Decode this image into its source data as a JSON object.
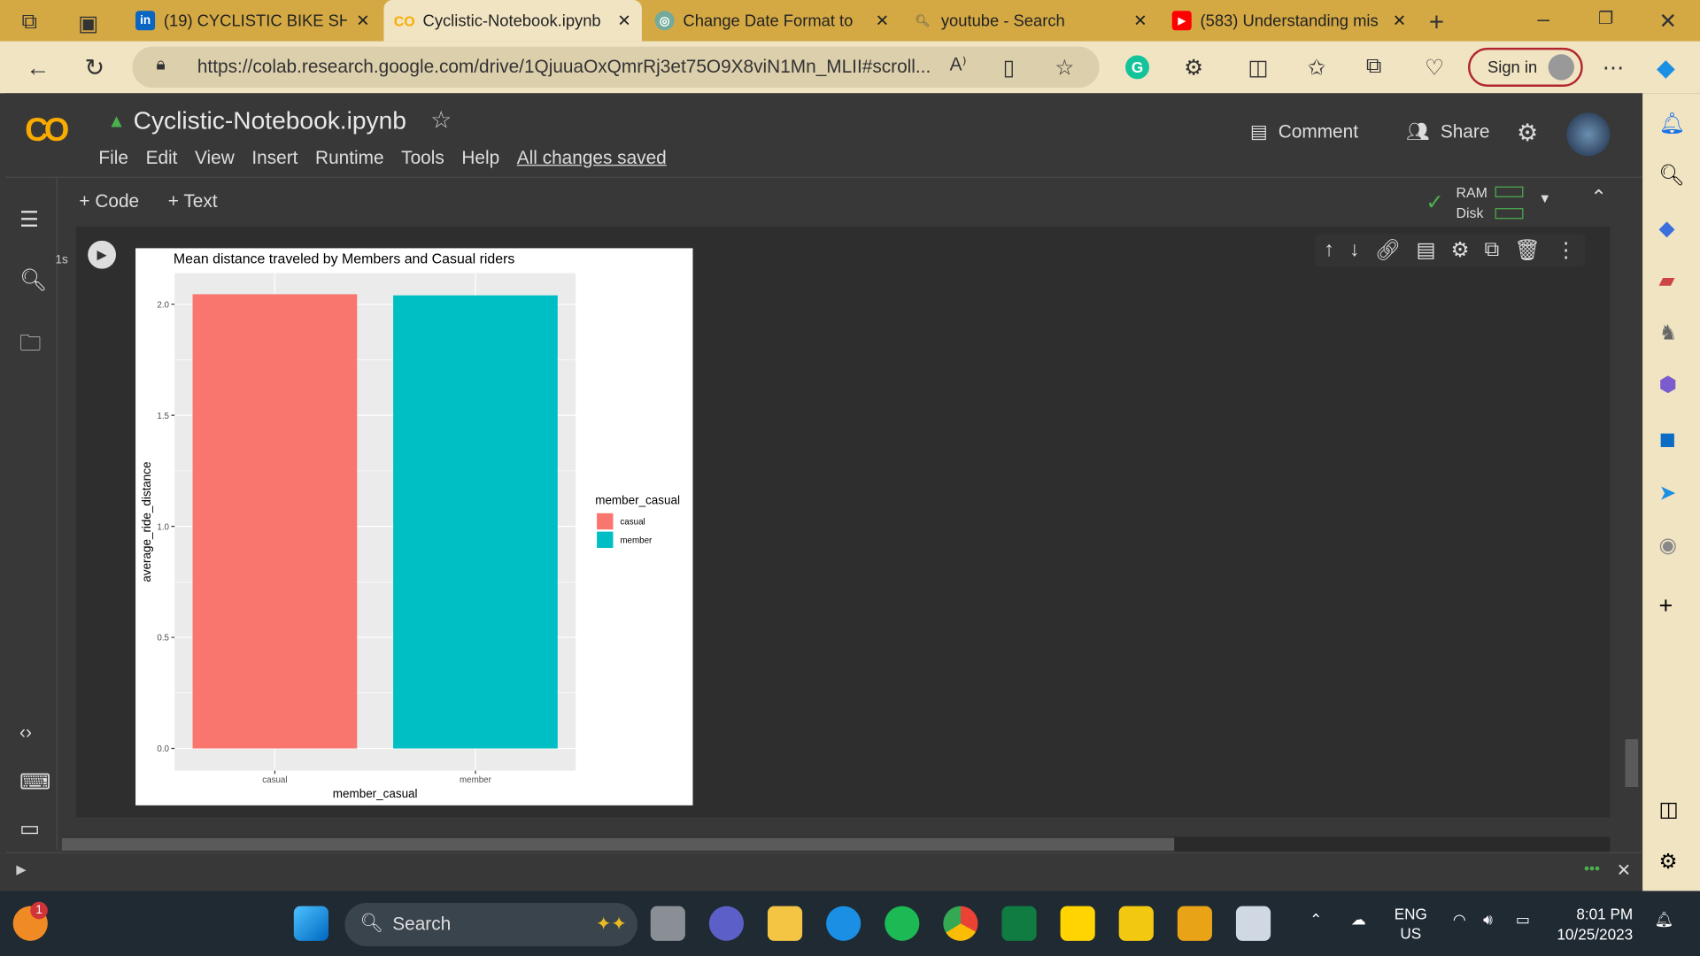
{
  "browser": {
    "tabs": [
      {
        "title": "(19) CYCLISTIC BIKE SHA",
        "icon": "linkedin-icon",
        "active": false
      },
      {
        "title": "Cyclistic-Notebook.ipynb",
        "icon": "colab-icon",
        "active": true
      },
      {
        "title": "Change Date Format to",
        "icon": "chatgpt-icon",
        "active": false
      },
      {
        "title": "youtube - Search",
        "icon": "search-icon",
        "active": false
      },
      {
        "title": "(583) Understanding mis",
        "icon": "youtube-icon",
        "active": false
      }
    ],
    "url": "https://colab.research.google.com/drive/1QjuuaOxQmrRj3et75O9X8viN1Mn_MLII#scroll...",
    "sign_in": "Sign in"
  },
  "colab": {
    "logo": "CO",
    "notebook_title": "Cyclistic-Notebook.ipynb",
    "menu": [
      "File",
      "Edit",
      "View",
      "Insert",
      "Runtime",
      "Tools",
      "Help"
    ],
    "saved_status": "All changes saved",
    "comment": "Comment",
    "share": "Share",
    "add_code": "+ Code",
    "add_text": "+ Text",
    "ram": "RAM",
    "disk": "Disk",
    "exec_time": "1s"
  },
  "chart_data": {
    "type": "bar",
    "title": "Mean distance traveled by Members and Casual riders",
    "xlabel": "member_casual",
    "ylabel": "average_ride_distance",
    "categories": [
      "casual",
      "member"
    ],
    "values": [
      2.045,
      2.04
    ],
    "colors": [
      "#f8766d",
      "#00bfc4"
    ],
    "ylim": [
      -0.1,
      2.14
    ],
    "yticks": [
      "0.0",
      "0.5",
      "1.0",
      "1.5",
      "2.0"
    ],
    "ytick_values": [
      0,
      0.5,
      1,
      1.5,
      2
    ],
    "legend": {
      "title": "member_casual",
      "entries": [
        "casual",
        "member"
      ],
      "placement": "right"
    },
    "grid": true
  },
  "taskbar": {
    "search": "Search",
    "lang": "ENG",
    "region": "US",
    "time": "8:01 PM",
    "date": "10/25/2023",
    "notification_badge": "1"
  }
}
